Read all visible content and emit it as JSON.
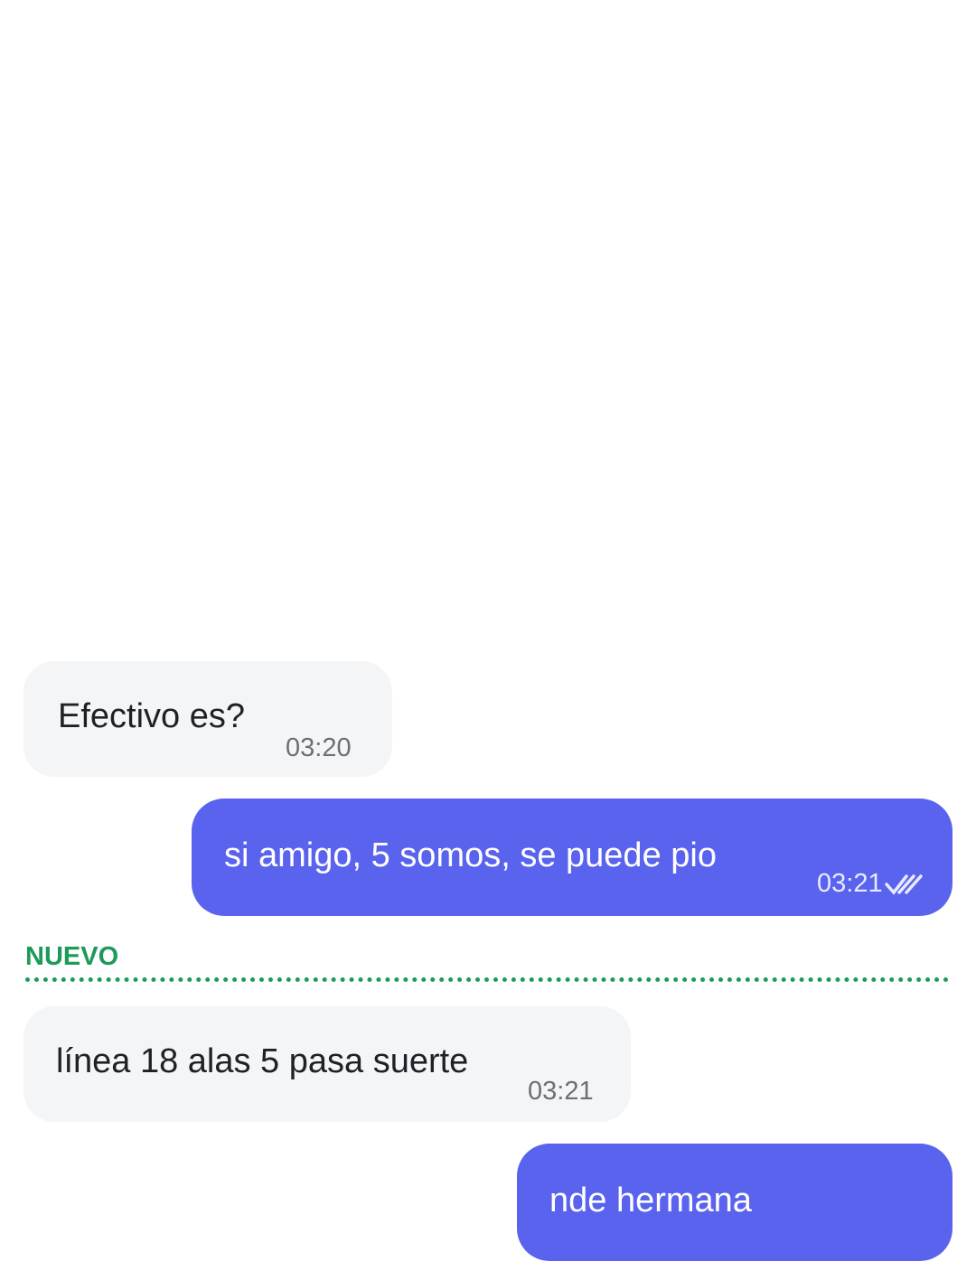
{
  "messages": [
    {
      "direction": "incoming",
      "text": "Efectivo es?",
      "time": "03:20"
    },
    {
      "direction": "outgoing",
      "text": "si amigo, 5 somos, se puede pio",
      "time": "03:21",
      "status": "read"
    },
    {
      "direction": "incoming",
      "text": "línea 18 alas 5 pasa suerte",
      "time": "03:21"
    },
    {
      "direction": "outgoing",
      "text": "nde hermana"
    }
  ],
  "divider": {
    "label": "NUEVO"
  },
  "colors": {
    "outgoing_bubble": "#5a63ee",
    "incoming_bubble": "#f4f5f7",
    "new_divider": "#1e9a5a"
  }
}
